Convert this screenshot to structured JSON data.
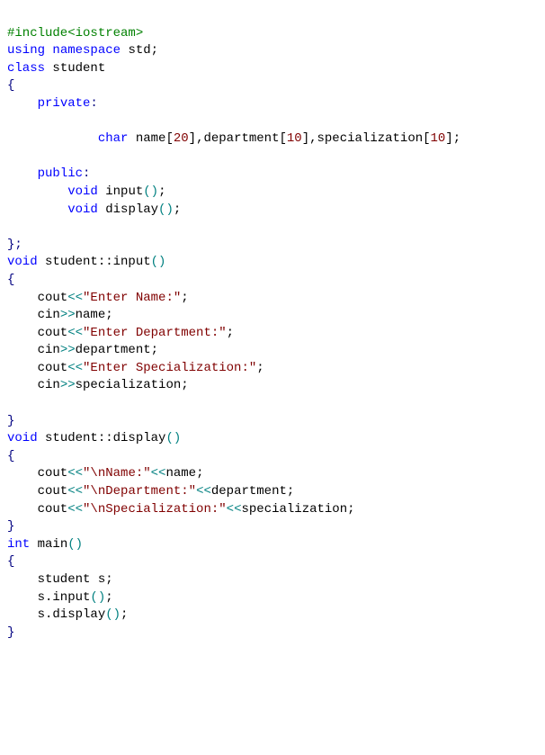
{
  "code": {
    "l1": "#include<iostream>",
    "l2a": "using ",
    "l2b": "namespace ",
    "l2c": "std;",
    "l3a": "class ",
    "l3b": "student",
    "l4": "{",
    "l5a": "    ",
    "l5b": "private",
    "l5c": ":",
    "l6": " ",
    "l7a": "            ",
    "l7b": "char ",
    "l7c": "name[",
    "l7d": "20",
    "l7e": "],department[",
    "l7f": "10",
    "l7g": "],specialization[",
    "l7h": "10",
    "l7i": "];",
    "l8": " ",
    "l9a": "    ",
    "l9b": "public",
    "l9c": ":",
    "l10a": "        ",
    "l10b": "void ",
    "l10c": "input",
    "l10d": "()",
    "l10e": ";",
    "l11a": "        ",
    "l11b": "void ",
    "l11c": "display",
    "l11d": "()",
    "l11e": ";",
    "l12": " ",
    "l13": "};",
    "l14a": "void ",
    "l14b": "student::input",
    "l14c": "()",
    "l15": "{",
    "l16a": "    cout",
    "l16b": "<<",
    "l16c": "\"Enter Name:\"",
    "l16d": ";",
    "l17a": "    cin",
    "l17b": ">>",
    "l17c": "name;",
    "l18a": "    cout",
    "l18b": "<<",
    "l18c": "\"Enter Department:\"",
    "l18d": ";",
    "l19a": "    cin",
    "l19b": ">>",
    "l19c": "department;",
    "l20a": "    cout",
    "l20b": "<<",
    "l20c": "\"Enter Specialization:\"",
    "l20d": ";",
    "l21a": "    cin",
    "l21b": ">>",
    "l21c": "specialization;",
    "l22": " ",
    "l23": "}",
    "l24a": "void ",
    "l24b": "student::display",
    "l24c": "()",
    "l25": "{",
    "l26a": "    cout",
    "l26b": "<<",
    "l26c": "\"\\nName:\"",
    "l26d": "<<",
    "l26e": "name;",
    "l27a": "    cout",
    "l27b": "<<",
    "l27c": "\"\\nDepartment:\"",
    "l27d": "<<",
    "l27e": "department;",
    "l28a": "    cout",
    "l28b": "<<",
    "l28c": "\"\\nSpecialization:\"",
    "l28d": "<<",
    "l28e": "specialization;",
    "l29": "}",
    "l30a": "int ",
    "l30b": "main",
    "l30c": "()",
    "l31": "{",
    "l32": "    student s;",
    "l33a": "    s.input",
    "l33b": "()",
    "l33c": ";",
    "l34a": "    s.display",
    "l34b": "()",
    "l34c": ";",
    "l35": "}"
  }
}
